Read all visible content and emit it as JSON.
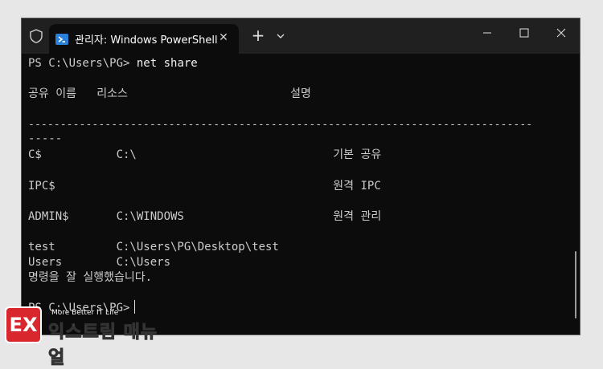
{
  "window": {
    "tab_title": "관리자: Windows PowerShell",
    "icons": [
      "shield-icon",
      "powershell-icon",
      "close-icon",
      "plus-icon",
      "chevron-down-icon",
      "minimize-icon",
      "maximize-icon",
      "window-close-icon"
    ]
  },
  "terminal": {
    "prompt_line": "PS C:\\Users\\PG>",
    "command": "net share",
    "header": "공유 이름   리소스                        설명",
    "separator_1": "-------------------------------------------------------------------------------",
    "separator_2": "-----",
    "rows": [
      "C$           C:\\                             기본 공유",
      "IPC$                                         원격 IPC",
      "ADMIN$       C:\\WINDOWS                      원격 관리",
      "test         C:\\Users\\PG\\Desktop\\test",
      "Users        C:\\Users"
    ],
    "result": "명령을 잘 실행했습니다.",
    "final_prompt": "PS C:\\Users\\PG>"
  },
  "watermark": {
    "tagline": "More Better IT Life",
    "name": "익스트림 매뉴얼",
    "mark": "EX"
  },
  "colors": {
    "terminal_bg": "#0c0c0c",
    "titlebar_bg": "#202020",
    "text": "#cccccc",
    "logo_red": "#d9272e"
  }
}
